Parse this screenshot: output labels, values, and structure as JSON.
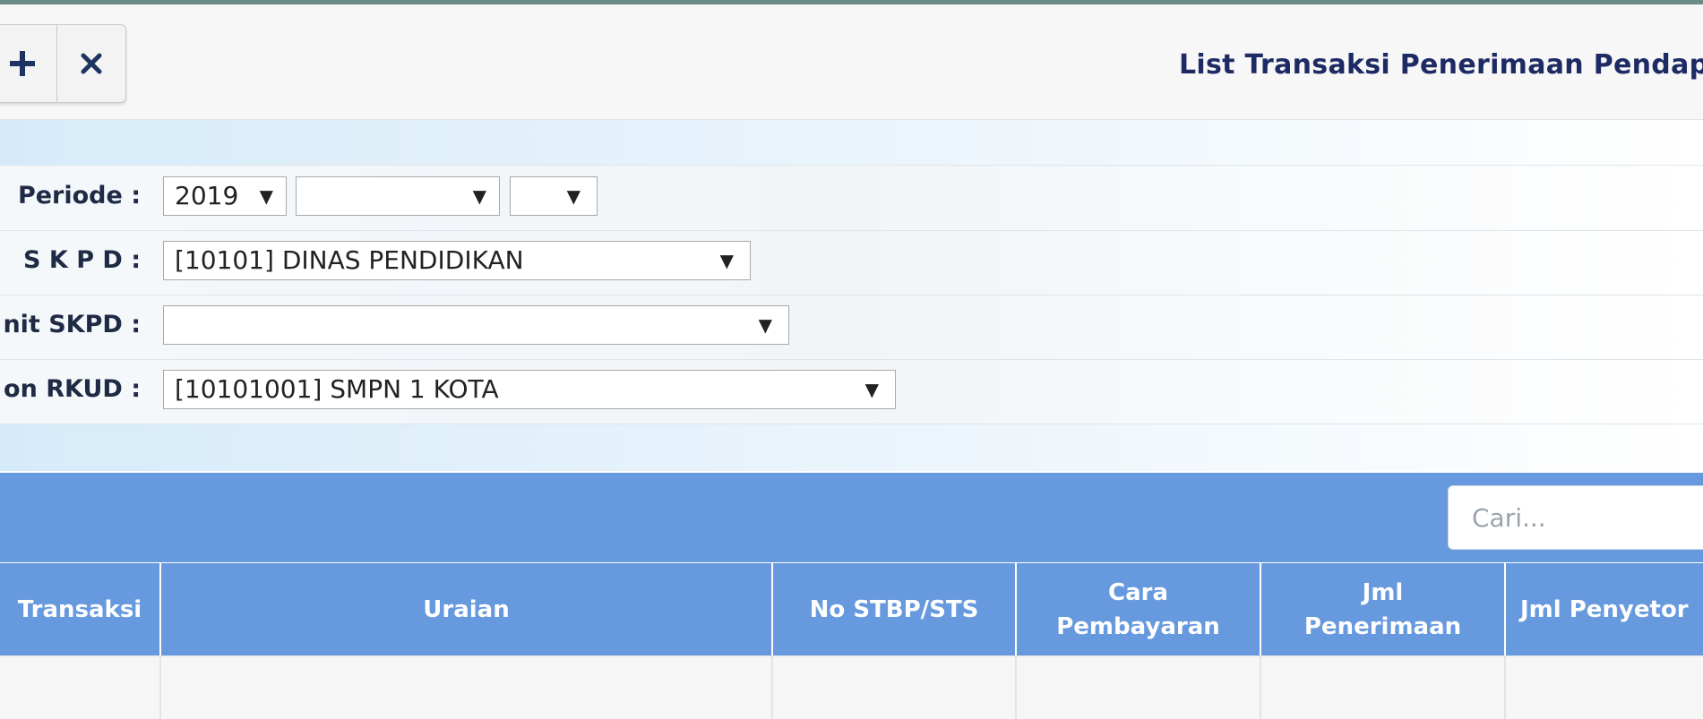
{
  "toolbar": {
    "add_icon": "plus-icon",
    "close_icon": "x-icon"
  },
  "page": {
    "title": "List Transaksi Penerimaan Pendapa"
  },
  "filters": {
    "periode": {
      "label": "Periode :",
      "year": "2019",
      "month": "",
      "day": ""
    },
    "skpd": {
      "label": "S K P D :",
      "value": "[10101] DINAS PENDIDIKAN"
    },
    "unit_skpd": {
      "label": "nit SKPD :",
      "value": ""
    },
    "rkud": {
      "label": "on RKUD :",
      "value": "[10101001] SMPN 1 KOTA"
    },
    "caret": "▼"
  },
  "search": {
    "placeholder": "Cari..."
  },
  "table": {
    "columns": [
      "Transaksi",
      "Uraian",
      "No STBP/STS",
      "Cara Pembayaran",
      "Jml Penerimaan",
      "Jml Penyetor"
    ]
  }
}
